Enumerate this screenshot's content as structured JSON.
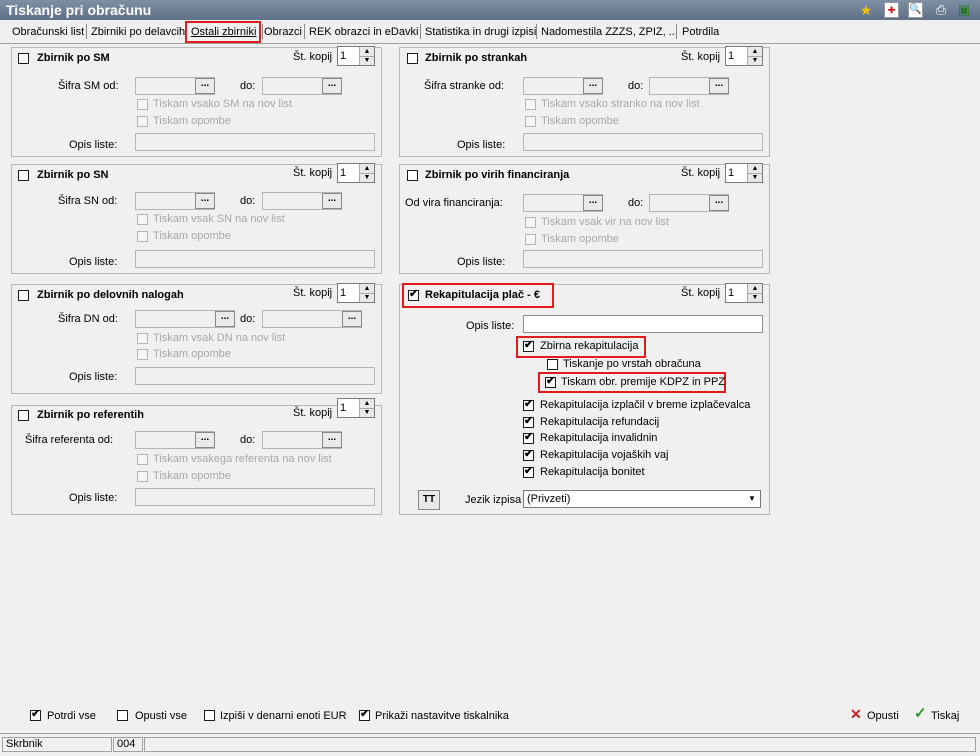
{
  "window": {
    "title": "Tiskanje pri obračunu"
  },
  "tabs": [
    "Obračunski list",
    "Zbirniki po delavcih",
    "Ostali zbirniki",
    "Obrazci",
    "REK obrazci  in eDavki",
    "Statistika in drugi izpisi",
    "Nadomestila ZZZS, ZPIZ, ...",
    "Potrdila"
  ],
  "common": {
    "copies_label": "Št. kopij",
    "copies_value": "1",
    "to_label": "do:",
    "desc_label": "Opis liste:",
    "print_notes": "Tiskam opombe",
    "ellipsis": "..."
  },
  "sm": {
    "title": "Zbirnik po SM",
    "from_label": "Šifra SM od:",
    "newpage": "Tiskam vsako SM na nov list"
  },
  "sn": {
    "title": "Zbirnik po SN",
    "from_label": "Šifra SN od:",
    "newpage": "Tiskam vsak SN na nov list"
  },
  "dn": {
    "title": "Zbirnik po delovnih nalogah",
    "from_label": "Šifra DN od:",
    "newpage": "Tiskam vsak DN na nov list"
  },
  "ref": {
    "title": "Zbirnik po referentih",
    "from_label": "Šifra referenta od:",
    "newpage": "Tiskam vsakega referenta na nov list"
  },
  "str": {
    "title": "Zbirnik po strankah",
    "from_label": "Šifra stranke od:",
    "newpage": "Tiskam vsako stranko na nov list"
  },
  "vir": {
    "title": "Zbirnik po virih financiranja",
    "from_label": "Od vira financiranja:",
    "newpage": "Tiskam vsak vir na nov list"
  },
  "rek": {
    "title": "Rekapitulacija plač - €",
    "zbirna": "Zbirna rekapitulacija",
    "po_vrstah": "Tiskanje po vrstah obračuna",
    "kdpz": "Tiskam obr. premije KDPZ in PPZ",
    "izplacil": "Rekapitulacija izplačil v breme izplačevalca",
    "refundacij": "Rekapitulacija refundacij",
    "invalidnin": "Rekapitulacija invalidnin",
    "vojaskih": "Rekapitulacija vojaških vaj",
    "bonitet": "Rekapitulacija bonitet",
    "lang_label": "Jezik izpisa",
    "lang_value": "(Privzeti)",
    "tt_icon_text": "TT"
  },
  "bottom": {
    "potrdi_vse": "Potrdi vse",
    "opusti_vse": "Opusti vse",
    "izpisi_eur": "Izpiši v denarni enoti EUR",
    "nastavitve": "Prikaži nastavitve tiskalnika",
    "opusti": "Opusti",
    "tiskaj": "Tiskaj"
  },
  "status": {
    "user": "Skrbnik",
    "code": "004"
  },
  "icons": {
    "star": "star-icon",
    "pdf": "pdf-icon",
    "preview": "print-preview-icon",
    "printer": "printer-icon",
    "exit": "exit-icon"
  },
  "colors": {
    "highlight": "#e01c1c",
    "titlebar": "#6a7c93"
  }
}
